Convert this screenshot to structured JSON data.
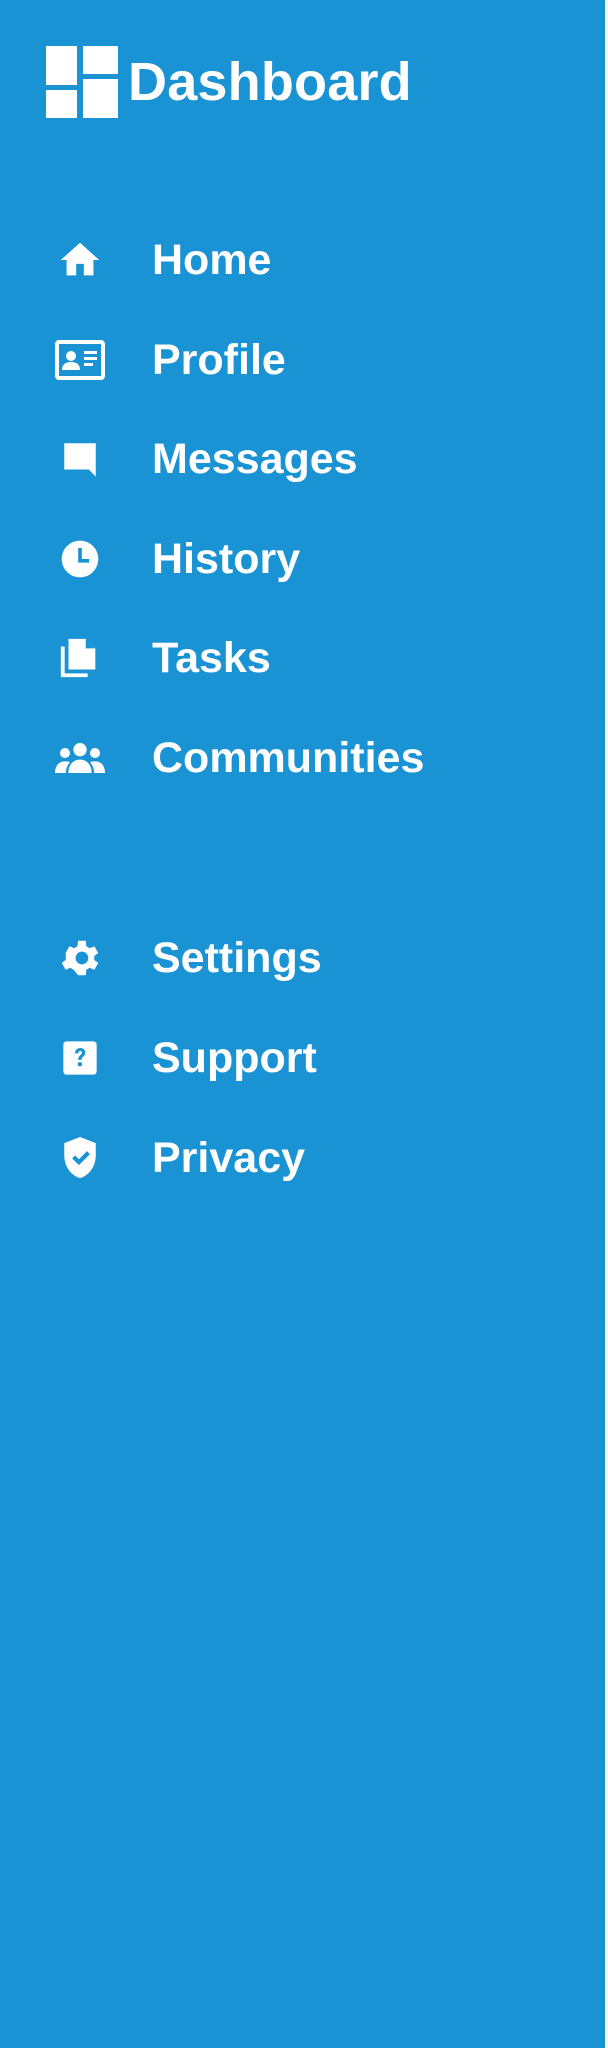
{
  "app": {
    "title": "Dashboard",
    "icon": "dashboard-icon"
  },
  "colors": {
    "sidebar_bg": "#1a93d4",
    "text": "#ffffff"
  },
  "nav": {
    "primary": [
      {
        "label": "Home",
        "icon": "home-icon"
      },
      {
        "label": "Profile",
        "icon": "id-card-icon"
      },
      {
        "label": "Messages",
        "icon": "message-icon"
      },
      {
        "label": "History",
        "icon": "clock-icon"
      },
      {
        "label": "Tasks",
        "icon": "documents-icon"
      },
      {
        "label": "Communities",
        "icon": "people-icon"
      }
    ],
    "secondary": [
      {
        "label": "Settings",
        "icon": "gear-icon"
      },
      {
        "label": "Support",
        "icon": "help-icon"
      },
      {
        "label": "Privacy",
        "icon": "shield-check-icon"
      }
    ]
  }
}
